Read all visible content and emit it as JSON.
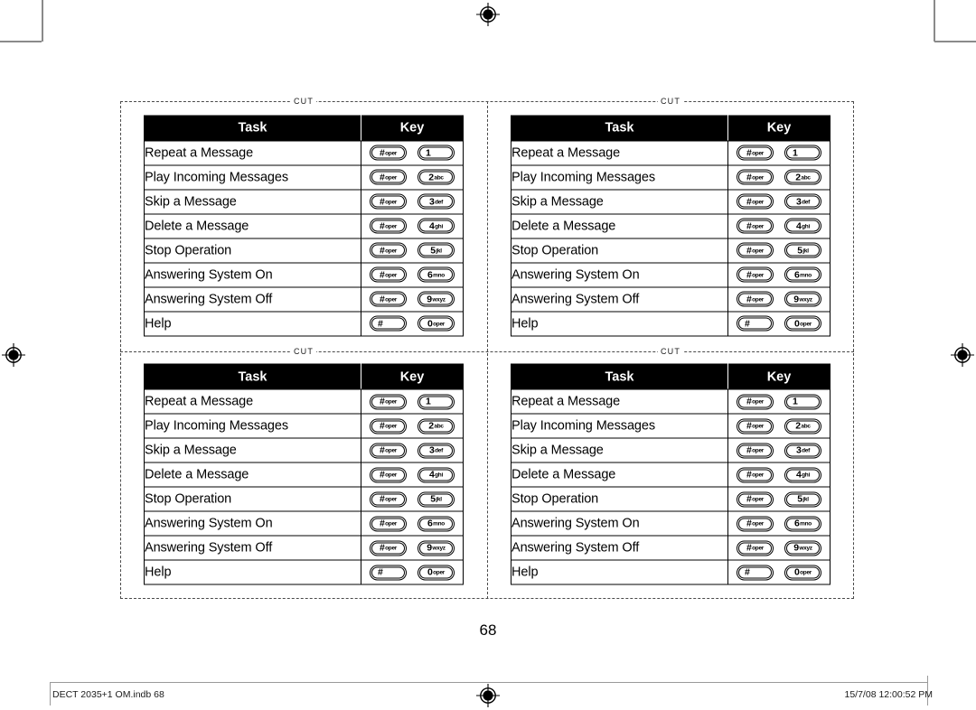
{
  "page": {
    "number": "68",
    "footer_left": "DECT 2035+1 OM.indb   68",
    "footer_right": "15/7/08   12:00:52 PM"
  },
  "cut_markers": [
    {
      "label": "CUT"
    },
    {
      "label": "CUT"
    },
    {
      "label": "CUT"
    },
    {
      "label": "CUT"
    }
  ],
  "table": {
    "headers": {
      "task": "Task",
      "key": "Key"
    },
    "rows": [
      {
        "task": "Repeat a Message",
        "key1": {
          "digit": "#",
          "sub": "oper"
        },
        "key2": {
          "digit": "1",
          "sub": ""
        }
      },
      {
        "task": "Play Incoming Messages",
        "key1": {
          "digit": "#",
          "sub": "oper"
        },
        "key2": {
          "digit": "2",
          "sub": "abc"
        }
      },
      {
        "task": "Skip a Message",
        "key1": {
          "digit": "#",
          "sub": "oper"
        },
        "key2": {
          "digit": "3",
          "sub": "def"
        }
      },
      {
        "task": "Delete a Message",
        "key1": {
          "digit": "#",
          "sub": "oper"
        },
        "key2": {
          "digit": "4",
          "sub": "ghi"
        }
      },
      {
        "task": "Stop Operation",
        "key1": {
          "digit": "#",
          "sub": "oper"
        },
        "key2": {
          "digit": "5",
          "sub": "jkl"
        }
      },
      {
        "task": "Answering System On",
        "key1": {
          "digit": "#",
          "sub": "oper"
        },
        "key2": {
          "digit": "6",
          "sub": "mno"
        }
      },
      {
        "task": "Answering System Off",
        "key1": {
          "digit": "#",
          "sub": "oper"
        },
        "key2": {
          "digit": "9",
          "sub": "wxyz"
        }
      },
      {
        "task": "Help",
        "key1": {
          "digit": "#",
          "sub": ""
        },
        "key2": {
          "digit": "0",
          "sub": "oper"
        }
      }
    ]
  },
  "colors": {
    "header_bg": "#000000",
    "header_text": "#ffffff",
    "body_text": "#000000",
    "cut_line": "#4a4a4a",
    "crop_mark": "#8a8a8a"
  }
}
